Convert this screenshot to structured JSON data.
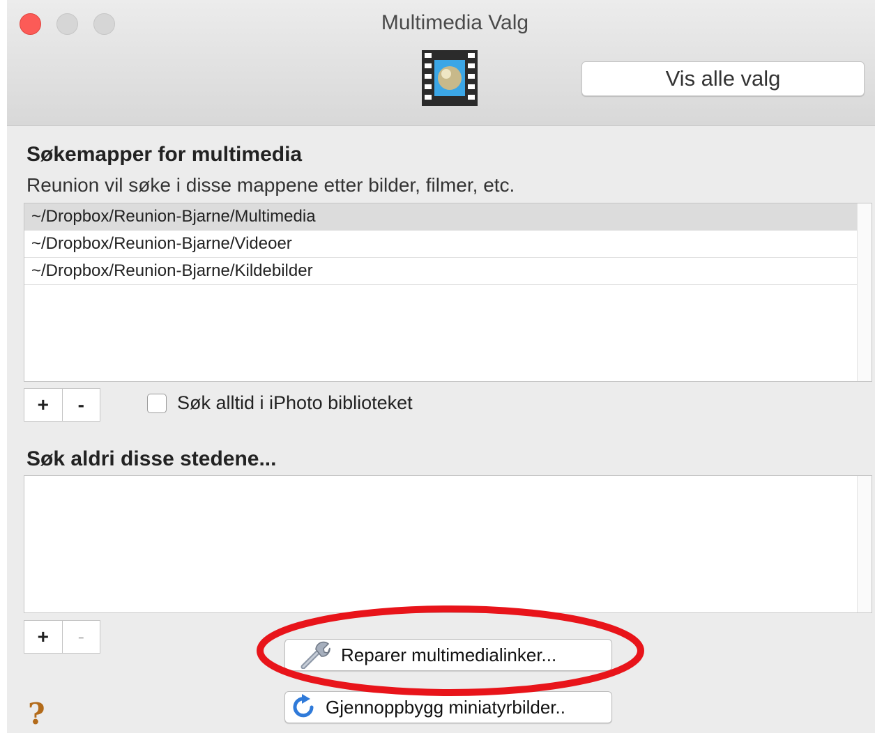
{
  "window": {
    "title": "Multimedia Valg",
    "toolbar_icon": "film-strip-icon",
    "show_all_label": "Vis alle valg"
  },
  "search_folders": {
    "title": "Søkemapper for multimedia",
    "description": "Reunion vil søke i disse mappene etter bilder, filmer, etc.",
    "items": [
      {
        "path": "~/Dropbox/Reunion-Bjarne/Multimedia",
        "selected": true
      },
      {
        "path": "~/Dropbox/Reunion-Bjarne/Videoer",
        "selected": false
      },
      {
        "path": "~/Dropbox/Reunion-Bjarne/Kildebilder",
        "selected": false
      }
    ],
    "add_label": "+",
    "remove_label": "-",
    "iphoto_checkbox_label": "Søk alltid i iPhoto biblioteket",
    "iphoto_checked": false
  },
  "exclude": {
    "title": "Søk aldri disse stedene...",
    "items": [],
    "add_label": "+",
    "remove_label": "-"
  },
  "actions": {
    "repair_label": "Reparer multimedialinker...",
    "repair_icon": "wrench-icon",
    "rebuild_label": "Gjennoppbygg miniatyrbilder..",
    "rebuild_icon": "refresh-icon",
    "help_label": "?"
  },
  "colors": {
    "close": "#fc5b57",
    "highlight": "#e8141a",
    "rebuild_icon": "#2f7ad9",
    "help": "#b36b1a"
  }
}
